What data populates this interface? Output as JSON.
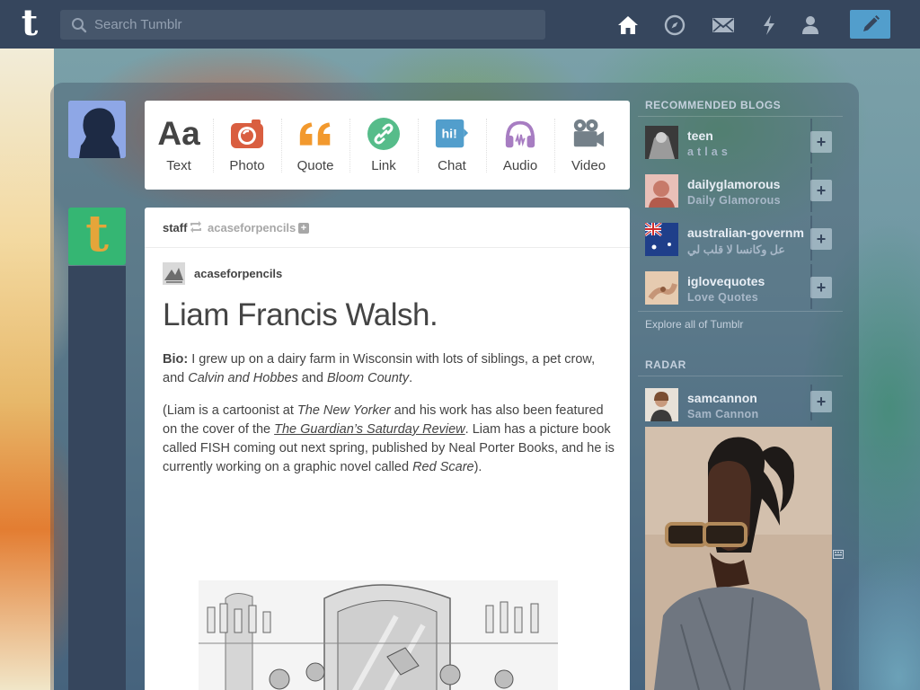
{
  "search": {
    "placeholder": "Search Tumblr"
  },
  "nav": {
    "logo": "t",
    "icons": [
      "home-icon",
      "explore-compass-icon",
      "inbox-mail-icon",
      "activity-lightning-icon",
      "account-person-icon"
    ],
    "compose_icon": "pencil-icon"
  },
  "post_types": [
    {
      "label": "Text",
      "icon": "text-aa-icon",
      "color": "#444444"
    },
    {
      "label": "Photo",
      "icon": "camera-icon",
      "color": "#d95e40"
    },
    {
      "label": "Quote",
      "icon": "quote-icon",
      "color": "#f2992e"
    },
    {
      "label": "Link",
      "icon": "link-icon",
      "color": "#56bc8a"
    },
    {
      "label": "Chat",
      "icon": "chat-bubble-icon",
      "color": "#529ecc"
    },
    {
      "label": "Audio",
      "icon": "headphones-icon",
      "color": "#a77dc2"
    },
    {
      "label": "Video",
      "icon": "video-camera-icon",
      "color": "#748089"
    }
  ],
  "post": {
    "reblogger": "staff",
    "source": "acaseforpencils",
    "follow_symbol": "+",
    "blog_name": "acaseforpencils",
    "title": "Liam Francis Walsh.",
    "bio_label": "Bio:",
    "bio_text_1": " I grew up on a dairy farm in Wisconsin with lots of siblings, a pet crow, and ",
    "bio_italic_1": "Calvin and Hobbes",
    "bio_text_2": " and ",
    "bio_italic_2": "Bloom County",
    "bio_text_3": ".",
    "p2_text_1": "(Liam is a cartoonist at ",
    "p2_italic_1": "The New Yorker",
    "p2_text_2": " and his work has also been featured on the cover of the ",
    "p2_link": "The Guardian’s Saturday Review",
    "p2_text_3": ". Liam has a picture book called FISH coming out next spring, published by Neal Porter Books, and he is currently working on a graphic novel called ",
    "p2_italic_2": "Red Scare",
    "p2_text_4": ")."
  },
  "sidebar": {
    "recommended_heading": "RECOMMENDED BLOGS",
    "recommended": [
      {
        "name": "teen",
        "subtitle": "a t l a s",
        "add": "+"
      },
      {
        "name": "dailyglamorous",
        "subtitle": "Daily Glamorous",
        "add": "+"
      },
      {
        "name": "australian-governm",
        "subtitle": "عل وكانسا لا قلب لي",
        "add": "+"
      },
      {
        "name": "iglovequotes",
        "subtitle": "Love Quotes",
        "add": "+"
      }
    ],
    "explore": "Explore all of Tumblr",
    "radar_heading": "RADAR",
    "radar": {
      "name": "samcannon",
      "subtitle": "Sam Cannon",
      "add": "+"
    }
  }
}
